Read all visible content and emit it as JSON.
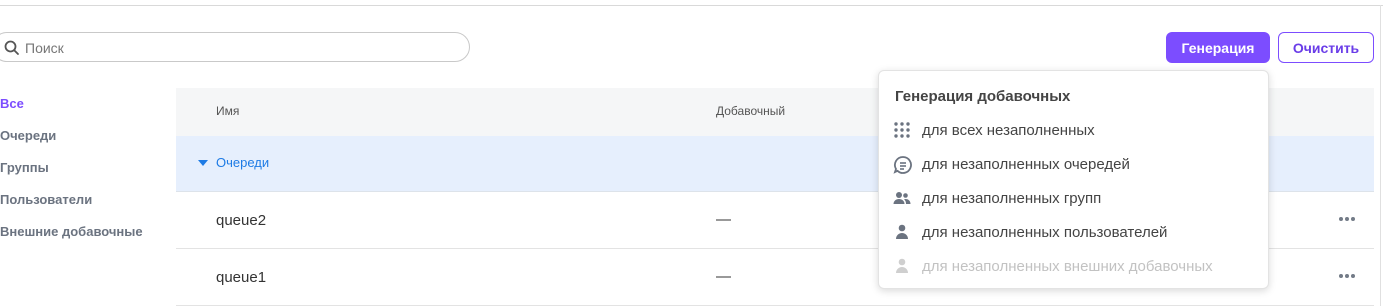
{
  "search": {
    "placeholder": "Поиск",
    "value": ""
  },
  "toolbar": {
    "generate_label": "Генерация",
    "clear_label": "Очистить"
  },
  "sidebar": {
    "items": [
      {
        "label": "Все",
        "active": true
      },
      {
        "label": "Очереди",
        "active": false
      },
      {
        "label": "Группы",
        "active": false
      },
      {
        "label": "Пользователи",
        "active": false
      },
      {
        "label": "Внешние добавочные",
        "active": false
      }
    ]
  },
  "table": {
    "columns": [
      "Имя",
      "Добавочный"
    ],
    "group": {
      "label": "Очереди",
      "expanded": true
    },
    "rows": [
      {
        "name": "queue2",
        "extension": "—"
      },
      {
        "name": "queue1",
        "extension": "—"
      }
    ]
  },
  "dropdown": {
    "title": "Генерация добавочных",
    "items": [
      {
        "label": "для всех незаполненных",
        "icon": "dialpad-icon",
        "disabled": false
      },
      {
        "label": "для незаполненных очередей",
        "icon": "queue-icon",
        "disabled": false
      },
      {
        "label": "для незаполненных групп",
        "icon": "group-icon",
        "disabled": false
      },
      {
        "label": "для незаполненных пользователей",
        "icon": "user-icon",
        "disabled": false
      },
      {
        "label": "для незаполненных внешних добавочных",
        "icon": "external-user-icon",
        "disabled": true
      }
    ]
  },
  "colors": {
    "accent": "#7c4dff",
    "link": "#1e7be5",
    "group_row_bg": "#e6effd",
    "header_bg": "#f5f6f7"
  }
}
